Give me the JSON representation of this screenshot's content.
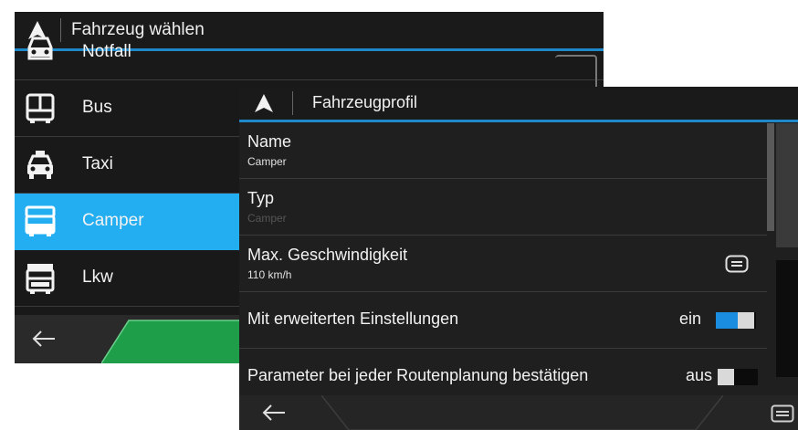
{
  "back_panel": {
    "title": "Fahrzeug wählen",
    "items": [
      {
        "label": "Notfall",
        "icon": "emergency-vehicle-icon"
      },
      {
        "label": "Bus",
        "icon": "bus-icon"
      },
      {
        "label": "Taxi",
        "icon": "taxi-icon"
      },
      {
        "label": "Camper",
        "icon": "camper-icon",
        "selected": true
      },
      {
        "label": "Lkw",
        "icon": "truck-icon"
      }
    ]
  },
  "front_panel": {
    "title": "Fahrzeugprofil",
    "rows": [
      {
        "name": "Name",
        "value": "Camper"
      },
      {
        "name": "Typ",
        "value": "Camper"
      },
      {
        "name": "Max. Geschwindigkeit",
        "value": "110 km/h"
      },
      {
        "name": "Mit erweiterten Einstellungen",
        "state": "ein"
      },
      {
        "name": "Parameter bei jeder Routenplanung bestätigen",
        "state": "aus"
      }
    ]
  },
  "colors": {
    "accent": "#1e88c8",
    "selected": "#22aef0",
    "green_button": "#1f9e4a",
    "toggle_on": "#1a8de0"
  }
}
